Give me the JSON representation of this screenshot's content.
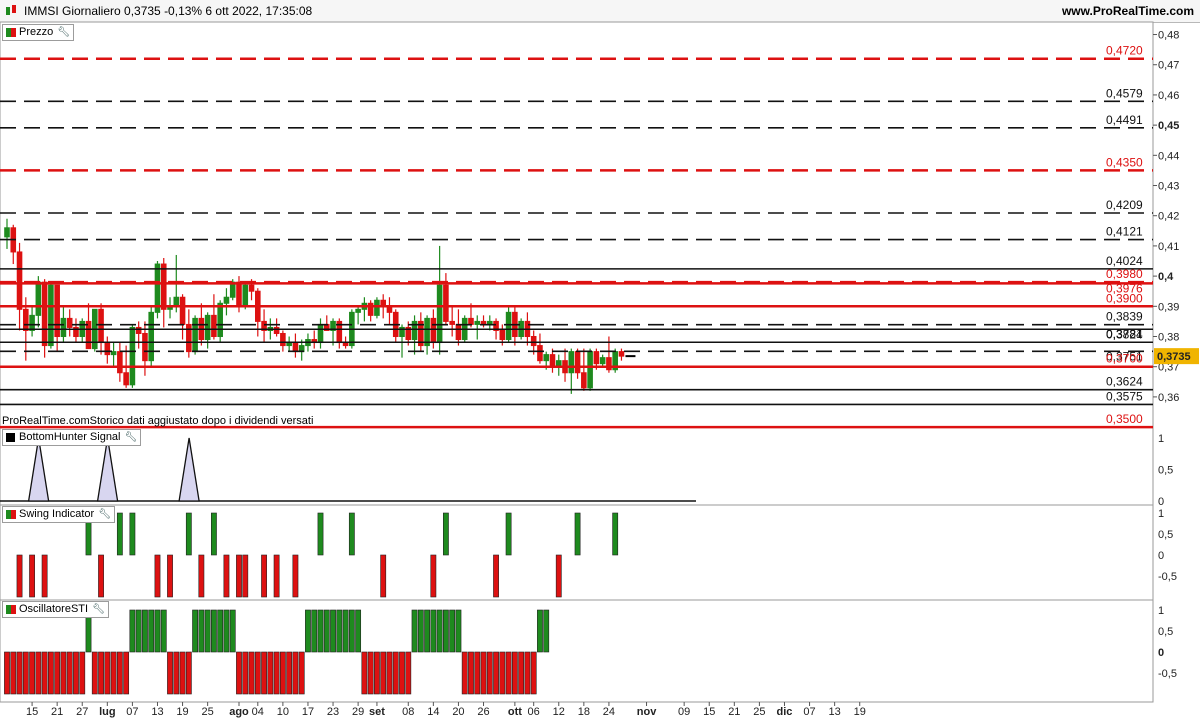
{
  "header": {
    "ticker_text": "IMMSI Giornaliero 0,3735 -0,13% 6 ott 2022, 17:35:08",
    "site": "www.ProRealTime.com"
  },
  "price_panel": {
    "label": "Prezzo",
    "footer_note": "ProRealTime.comStorico dati aggiustato dopo i dividendi versati",
    "current_price": "0,3735",
    "y_ticks": [
      "0,48",
      "0,47",
      "0,46",
      "0,45",
      "0,44",
      "0,43",
      "0,42",
      "0,41",
      "0,4",
      "0,39",
      "0,38",
      "0,37",
      "0,36"
    ],
    "levels": [
      {
        "label": "0,4720",
        "value": 0.472,
        "color": "#dd1111",
        "style": "dashed"
      },
      {
        "label": "0,4579",
        "value": 0.4579,
        "color": "#111111",
        "style": "dashed"
      },
      {
        "label": "0,4491",
        "value": 0.4491,
        "color": "#111111",
        "style": "dashed"
      },
      {
        "label": "0,4350",
        "value": 0.435,
        "color": "#dd1111",
        "style": "dashed"
      },
      {
        "label": "0,4209",
        "value": 0.4209,
        "color": "#111111",
        "style": "dashed"
      },
      {
        "label": "0,4121",
        "value": 0.4121,
        "color": "#111111",
        "style": "dashed"
      },
      {
        "label": "0,4024",
        "value": 0.4024,
        "color": "#111111",
        "style": "solid"
      },
      {
        "label": "0,3980",
        "value": 0.398,
        "color": "#dd1111",
        "style": "dashed"
      },
      {
        "label": "0,3976",
        "value": 0.3976,
        "color": "#dd1111",
        "style": "solid"
      },
      {
        "label": "0,3900",
        "value": 0.39,
        "color": "#dd1111",
        "style": "solid"
      },
      {
        "label": "0,3839",
        "value": 0.3839,
        "color": "#111111",
        "style": "dashed"
      },
      {
        "label": "0,3824",
        "value": 0.3824,
        "color": "#111111",
        "style": "solid"
      },
      {
        "label": "0,3781",
        "value": 0.3781,
        "color": "#111111",
        "style": "solid"
      },
      {
        "label": "0,3751",
        "value": 0.3751,
        "color": "#111111",
        "style": "dashed"
      },
      {
        "label": "0,3700",
        "value": 0.37,
        "color": "#dd1111",
        "style": "solid"
      },
      {
        "label": "0,3624",
        "value": 0.3624,
        "color": "#111111",
        "style": "solid"
      },
      {
        "label": "0,3575",
        "value": 0.3575,
        "color": "#111111",
        "style": "solid"
      },
      {
        "label": "0,3500",
        "value": 0.35,
        "color": "#dd1111",
        "style": "solid"
      }
    ]
  },
  "bottomhunter_panel": {
    "label": "BottomHunter Signal",
    "y_ticks": [
      "1",
      "0,5",
      "0"
    ]
  },
  "swing_panel": {
    "label": "Swing Indicator",
    "y_ticks": [
      "1",
      "0,5",
      "0",
      "-0,5"
    ]
  },
  "sti_panel": {
    "label": "OscillatoreSTI",
    "y_ticks": [
      "1",
      "0,5",
      "0",
      "-0,5"
    ]
  },
  "x_axis": {
    "labels": [
      {
        "text": "15",
        "bar": 4
      },
      {
        "text": "21",
        "bar": 8
      },
      {
        "text": "27",
        "bar": 12
      },
      {
        "text": "lug",
        "bar": 16,
        "bold": true
      },
      {
        "text": "07",
        "bar": 20
      },
      {
        "text": "13",
        "bar": 24
      },
      {
        "text": "19",
        "bar": 28
      },
      {
        "text": "25",
        "bar": 32
      },
      {
        "text": "ago",
        "bar": 37,
        "bold": true
      },
      {
        "text": "04",
        "bar": 40
      },
      {
        "text": "10",
        "bar": 44
      },
      {
        "text": "17",
        "bar": 48
      },
      {
        "text": "23",
        "bar": 52
      },
      {
        "text": "29",
        "bar": 56
      },
      {
        "text": "set",
        "bar": 59,
        "bold": true
      },
      {
        "text": "08",
        "bar": 64
      },
      {
        "text": "14",
        "bar": 68
      },
      {
        "text": "20",
        "bar": 72
      },
      {
        "text": "26",
        "bar": 76
      },
      {
        "text": "ott",
        "bar": 81,
        "bold": true
      },
      {
        "text": "06",
        "bar": 84
      },
      {
        "text": "12",
        "bar": 88
      },
      {
        "text": "18",
        "bar": 92
      },
      {
        "text": "24",
        "bar": 96
      },
      {
        "text": "nov",
        "bar": 102,
        "bold": true
      },
      {
        "text": "09",
        "bar": 108
      },
      {
        "text": "15",
        "bar": 112
      },
      {
        "text": "21",
        "bar": 116
      },
      {
        "text": "25",
        "bar": 120
      },
      {
        "text": "dic",
        "bar": 124,
        "bold": true
      },
      {
        "text": "07",
        "bar": 128
      },
      {
        "text": "13",
        "bar": 132
      },
      {
        "text": "19",
        "bar": 136
      }
    ]
  },
  "chart_data": [
    {
      "type": "candlestick",
      "title": "IMMSI Giornaliero",
      "ylim": [
        0.348,
        0.482
      ],
      "colors": {
        "up": "#1e8a1e",
        "down": "#dd1111"
      },
      "ohlc": [
        [
          0.413,
          0.419,
          0.409,
          0.416
        ],
        [
          0.416,
          0.417,
          0.404,
          0.408
        ],
        [
          0.408,
          0.411,
          0.382,
          0.389
        ],
        [
          0.389,
          0.393,
          0.372,
          0.382
        ],
        [
          0.382,
          0.39,
          0.38,
          0.387
        ],
        [
          0.387,
          0.4,
          0.383,
          0.398
        ],
        [
          0.398,
          0.399,
          0.373,
          0.377
        ],
        [
          0.377,
          0.398,
          0.376,
          0.397
        ],
        [
          0.397,
          0.397,
          0.375,
          0.38
        ],
        [
          0.38,
          0.39,
          0.378,
          0.386
        ],
        [
          0.386,
          0.389,
          0.38,
          0.383
        ],
        [
          0.383,
          0.386,
          0.378,
          0.38
        ],
        [
          0.38,
          0.386,
          0.378,
          0.385
        ],
        [
          0.385,
          0.391,
          0.377,
          0.376
        ],
        [
          0.376,
          0.388,
          0.375,
          0.389
        ],
        [
          0.389,
          0.391,
          0.374,
          0.378
        ],
        [
          0.378,
          0.38,
          0.371,
          0.374
        ],
        [
          0.374,
          0.378,
          0.37,
          0.375
        ],
        [
          0.375,
          0.378,
          0.365,
          0.368
        ],
        [
          0.368,
          0.377,
          0.363,
          0.364
        ],
        [
          0.364,
          0.384,
          0.363,
          0.383
        ],
        [
          0.383,
          0.385,
          0.376,
          0.381
        ],
        [
          0.381,
          0.385,
          0.367,
          0.372
        ],
        [
          0.372,
          0.39,
          0.37,
          0.388
        ],
        [
          0.388,
          0.405,
          0.386,
          0.404
        ],
        [
          0.404,
          0.406,
          0.383,
          0.389
        ],
        [
          0.389,
          0.393,
          0.386,
          0.39
        ],
        [
          0.39,
          0.407,
          0.388,
          0.393
        ],
        [
          0.393,
          0.394,
          0.379,
          0.384
        ],
        [
          0.384,
          0.389,
          0.373,
          0.375
        ],
        [
          0.375,
          0.387,
          0.374,
          0.386
        ],
        [
          0.386,
          0.391,
          0.377,
          0.379
        ],
        [
          0.379,
          0.388,
          0.376,
          0.387
        ],
        [
          0.387,
          0.394,
          0.379,
          0.38
        ],
        [
          0.38,
          0.392,
          0.378,
          0.391
        ],
        [
          0.391,
          0.396,
          0.387,
          0.393
        ],
        [
          0.393,
          0.399,
          0.392,
          0.398
        ],
        [
          0.398,
          0.4,
          0.388,
          0.39
        ],
        [
          0.39,
          0.398,
          0.389,
          0.397
        ],
        [
          0.397,
          0.399,
          0.392,
          0.395
        ],
        [
          0.395,
          0.396,
          0.38,
          0.385
        ],
        [
          0.385,
          0.389,
          0.378,
          0.382
        ],
        [
          0.382,
          0.386,
          0.379,
          0.383
        ],
        [
          0.383,
          0.386,
          0.38,
          0.381
        ],
        [
          0.381,
          0.382,
          0.375,
          0.377
        ],
        [
          0.377,
          0.38,
          0.375,
          0.378
        ],
        [
          0.378,
          0.381,
          0.373,
          0.375
        ],
        [
          0.375,
          0.379,
          0.372,
          0.377
        ],
        [
          0.377,
          0.381,
          0.375,
          0.379
        ],
        [
          0.379,
          0.382,
          0.376,
          0.378
        ],
        [
          0.378,
          0.386,
          0.376,
          0.384
        ],
        [
          0.384,
          0.387,
          0.383,
          0.382
        ],
        [
          0.382,
          0.386,
          0.377,
          0.385
        ],
        [
          0.385,
          0.386,
          0.376,
          0.378
        ],
        [
          0.378,
          0.38,
          0.376,
          0.377
        ],
        [
          0.377,
          0.389,
          0.376,
          0.388
        ],
        [
          0.388,
          0.39,
          0.384,
          0.389
        ],
        [
          0.389,
          0.393,
          0.385,
          0.391
        ],
        [
          0.391,
          0.392,
          0.385,
          0.387
        ],
        [
          0.387,
          0.393,
          0.386,
          0.392
        ],
        [
          0.392,
          0.394,
          0.386,
          0.39
        ],
        [
          0.39,
          0.393,
          0.384,
          0.388
        ],
        [
          0.388,
          0.389,
          0.378,
          0.38
        ],
        [
          0.38,
          0.384,
          0.373,
          0.383
        ],
        [
          0.383,
          0.385,
          0.377,
          0.379
        ],
        [
          0.379,
          0.387,
          0.374,
          0.385
        ],
        [
          0.385,
          0.388,
          0.375,
          0.377
        ],
        [
          0.377,
          0.387,
          0.374,
          0.386
        ],
        [
          0.386,
          0.389,
          0.376,
          0.378
        ],
        [
          0.378,
          0.41,
          0.374,
          0.397
        ],
        [
          0.397,
          0.401,
          0.384,
          0.385
        ],
        [
          0.385,
          0.39,
          0.38,
          0.384
        ],
        [
          0.384,
          0.389,
          0.377,
          0.379
        ],
        [
          0.379,
          0.387,
          0.378,
          0.386
        ],
        [
          0.386,
          0.391,
          0.383,
          0.384
        ],
        [
          0.384,
          0.387,
          0.379,
          0.385
        ],
        [
          0.385,
          0.387,
          0.383,
          0.384
        ],
        [
          0.384,
          0.387,
          0.382,
          0.385
        ],
        [
          0.385,
          0.386,
          0.379,
          0.382
        ],
        [
          0.382,
          0.384,
          0.377,
          0.379
        ],
        [
          0.379,
          0.39,
          0.378,
          0.388
        ],
        [
          0.388,
          0.39,
          0.377,
          0.38
        ],
        [
          0.38,
          0.386,
          0.379,
          0.385
        ],
        [
          0.385,
          0.388,
          0.377,
          0.38
        ],
        [
          0.38,
          0.382,
          0.374,
          0.377
        ],
        [
          0.377,
          0.381,
          0.371,
          0.372
        ],
        [
          0.372,
          0.375,
          0.369,
          0.374
        ],
        [
          0.374,
          0.376,
          0.368,
          0.37
        ],
        [
          0.37,
          0.374,
          0.367,
          0.372
        ],
        [
          0.372,
          0.376,
          0.365,
          0.368
        ],
        [
          0.368,
          0.376,
          0.361,
          0.375
        ],
        [
          0.375,
          0.376,
          0.366,
          0.368
        ],
        [
          0.368,
          0.376,
          0.362,
          0.363
        ],
        [
          0.363,
          0.376,
          0.362,
          0.375
        ],
        [
          0.375,
          0.376,
          0.369,
          0.371
        ],
        [
          0.371,
          0.374,
          0.37,
          0.373
        ],
        [
          0.373,
          0.38,
          0.368,
          0.369
        ],
        [
          0.369,
          0.376,
          0.368,
          0.375
        ],
        [
          0.375,
          0.376,
          0.372,
          0.3735
        ]
      ]
    },
    {
      "type": "area",
      "title": "BottomHunter Signal",
      "ylim": [
        0,
        1.1
      ],
      "spikes_at_bar": [
        6,
        17,
        30
      ],
      "values_note": "all other bars 0"
    },
    {
      "type": "bar",
      "title": "Swing Indicator",
      "ylim": [
        -0.75,
        1.1
      ],
      "values": [
        0,
        0,
        -1,
        0,
        -1,
        0,
        -1,
        0,
        0,
        0,
        0,
        0,
        0,
        1,
        0,
        -1,
        0,
        0,
        1,
        0,
        1,
        0,
        0,
        0,
        -1,
        0,
        -1,
        0,
        0,
        1,
        0,
        -1,
        0,
        1,
        0,
        -1,
        0,
        -1,
        -1,
        0,
        0,
        -1,
        0,
        -1,
        0,
        0,
        -1,
        0,
        0,
        0,
        1,
        0,
        0,
        0,
        0,
        1,
        0,
        0,
        0,
        0,
        -1,
        0,
        0,
        0,
        0,
        0,
        0,
        0,
        -1,
        0,
        1,
        0,
        0,
        0,
        0,
        0,
        0,
        0,
        -1,
        0,
        1,
        0,
        0,
        0,
        0,
        0,
        0,
        0,
        -1,
        0,
        0,
        1,
        0,
        0,
        0,
        0,
        0,
        1,
        0
      ],
      "colors": {
        "positive": "#1e8a1e",
        "negative": "#dd1111"
      }
    },
    {
      "type": "bar",
      "title": "OscillatoreSTI",
      "ylim": [
        -0.75,
        1.1
      ],
      "values": [
        -1,
        -1,
        -1,
        -1,
        -1,
        -1,
        -1,
        -1,
        -1,
        -1,
        -1,
        -1,
        -1,
        1,
        -1,
        -1,
        -1,
        -1,
        -1,
        -1,
        1,
        1,
        1,
        1,
        1,
        1,
        -1,
        -1,
        -1,
        -1,
        1,
        1,
        1,
        1,
        1,
        1,
        1,
        -1,
        -1,
        -1,
        -1,
        -1,
        -1,
        -1,
        -1,
        -1,
        -1,
        -1,
        1,
        1,
        1,
        1,
        1,
        1,
        1,
        1,
        1,
        -1,
        -1,
        -1,
        -1,
        -1,
        -1,
        -1,
        -1,
        1,
        1,
        1,
        1,
        1,
        1,
        1,
        1,
        -1,
        -1,
        -1,
        -1,
        -1,
        -1,
        -1,
        -1,
        -1,
        -1,
        -1,
        -1,
        1,
        1
      ],
      "colors": {
        "positive": "#1e8a1e",
        "negative": "#dd1111"
      }
    }
  ]
}
